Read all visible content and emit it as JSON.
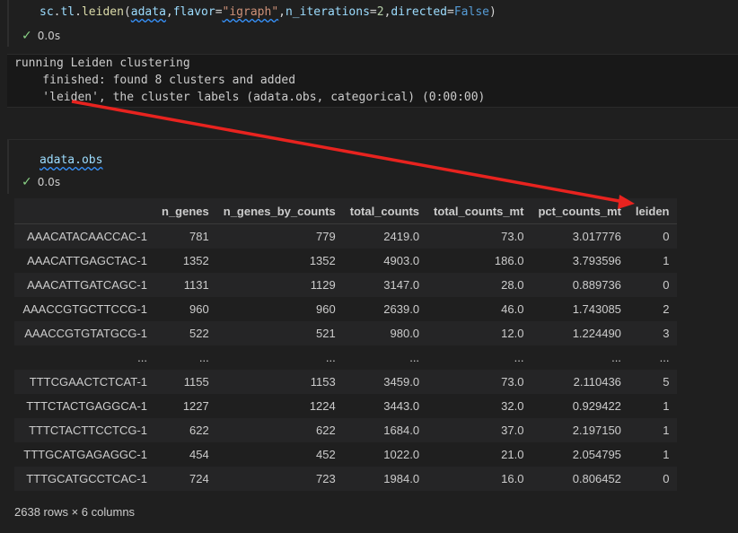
{
  "cell1": {
    "code_tokens": [
      {
        "t": "sc",
        "c": "t-plain"
      },
      {
        "t": ".",
        "c": "t-punc"
      },
      {
        "t": "tl",
        "c": "t-plain"
      },
      {
        "t": ".",
        "c": "t-punc"
      },
      {
        "t": "leiden",
        "c": "t-fn"
      },
      {
        "t": "(",
        "c": "t-punc"
      },
      {
        "t": "adata",
        "c": "t-plain squiggle"
      },
      {
        "t": ",",
        "c": "t-punc"
      },
      {
        "t": "flavor",
        "c": "t-plain"
      },
      {
        "t": "=",
        "c": "t-punc"
      },
      {
        "t": "\"igraph\"",
        "c": "t-str squiggle"
      },
      {
        "t": ",",
        "c": "t-punc"
      },
      {
        "t": "n_iterations",
        "c": "t-plain"
      },
      {
        "t": "=",
        "c": "t-punc"
      },
      {
        "t": "2",
        "c": "t-num"
      },
      {
        "t": ",",
        "c": "t-punc"
      },
      {
        "t": "directed",
        "c": "t-plain"
      },
      {
        "t": "=",
        "c": "t-punc"
      },
      {
        "t": "False",
        "c": "t-kw"
      },
      {
        "t": ")",
        "c": "t-punc"
      }
    ],
    "exec_time": "0.0s"
  },
  "output": {
    "lines": [
      "running Leiden clustering",
      "    finished: found 8 clusters and added",
      "    'leiden', the cluster labels (adata.obs, categorical) (0:00:00)"
    ]
  },
  "cell2": {
    "code": "adata.obs",
    "exec_time": "0.0s"
  },
  "table": {
    "columns": [
      "",
      "n_genes",
      "n_genes_by_counts",
      "total_counts",
      "total_counts_mt",
      "pct_counts_mt",
      "leiden"
    ],
    "rows": [
      [
        "AAACATACAACCAC-1",
        "781",
        "779",
        "2419.0",
        "73.0",
        "3.017776",
        "0"
      ],
      [
        "AAACATTGAGCTAC-1",
        "1352",
        "1352",
        "4903.0",
        "186.0",
        "3.793596",
        "1"
      ],
      [
        "AAACATTGATCAGC-1",
        "1131",
        "1129",
        "3147.0",
        "28.0",
        "0.889736",
        "0"
      ],
      [
        "AAACCGTGCTTCCG-1",
        "960",
        "960",
        "2639.0",
        "46.0",
        "1.743085",
        "2"
      ],
      [
        "AAACCGTGTATGCG-1",
        "522",
        "521",
        "980.0",
        "12.0",
        "1.224490",
        "3"
      ],
      [
        "...",
        "...",
        "...",
        "...",
        "...",
        "...",
        "..."
      ],
      [
        "TTTCGAACTCTCAT-1",
        "1155",
        "1153",
        "3459.0",
        "73.0",
        "2.110436",
        "5"
      ],
      [
        "TTTCTACTGAGGCA-1",
        "1227",
        "1224",
        "3443.0",
        "32.0",
        "0.929422",
        "1"
      ],
      [
        "TTTCTACTTCCTCG-1",
        "622",
        "622",
        "1684.0",
        "37.0",
        "2.197150",
        "1"
      ],
      [
        "TTTGCATGAGAGGC-1",
        "454",
        "452",
        "1022.0",
        "21.0",
        "2.054795",
        "1"
      ],
      [
        "TTTGCATGCCTCAC-1",
        "724",
        "723",
        "1984.0",
        "16.0",
        "0.806452",
        "0"
      ]
    ],
    "footer": "2638 rows × 6 columns"
  },
  "annotation": {
    "arrow_color": "#e8231f"
  }
}
